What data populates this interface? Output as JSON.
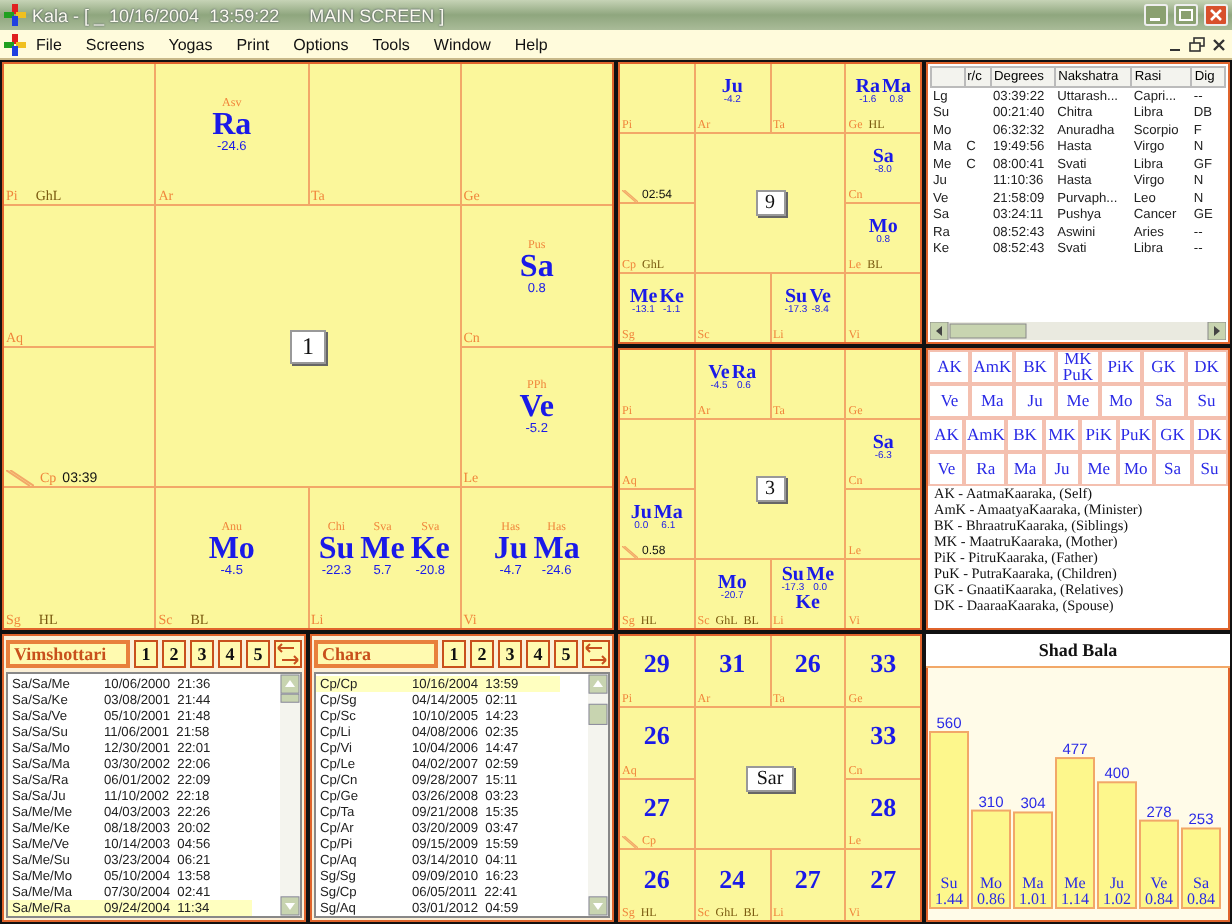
{
  "window": {
    "title": "Kala - [ _ 10/16/2004  13:59:22      MAIN SCREEN ]"
  },
  "menu": [
    "File",
    "Screens",
    "Yogas",
    "Print",
    "Options",
    "Tools",
    "Window",
    "Help"
  ],
  "charts": [
    {
      "kind": "planets",
      "label": "1",
      "cells": [
        {
          "sign": "Pi",
          "ascendant": false,
          "markers": [
            "GhL"
          ]
        },
        {
          "sign": "Ar",
          "ascendant": false,
          "planets": [
            {
              "name": "Ra",
              "nakshatra": "Asv",
              "value": "-24.6"
            }
          ]
        },
        {
          "sign": "Ta",
          "ascendant": false
        },
        {
          "sign": "Ge",
          "ascendant": false
        },
        {
          "sign": "Aq",
          "ascendant": false
        },
        {
          "sign": "Cn",
          "ascendant": false,
          "planets": [
            {
              "name": "Sa",
              "nakshatra": "Pus",
              "value": "0.8"
            }
          ]
        },
        {
          "sign": "Cp",
          "ascendant": true,
          "time": "03:39"
        },
        {
          "sign": "Le",
          "ascendant": false,
          "planets": [
            {
              "name": "Ve",
              "nakshatra": "PPh",
              "value": "-5.2"
            }
          ]
        },
        {
          "sign": "Sg",
          "ascendant": false,
          "markers": [
            "HL"
          ]
        },
        {
          "sign": "Sc",
          "ascendant": false,
          "markers": [
            "BL"
          ],
          "planets": [
            {
              "name": "Mo",
              "nakshatra": "Anu",
              "value": "-4.5"
            }
          ]
        },
        {
          "sign": "Li",
          "ascendant": false,
          "planets": [
            {
              "name": "Su",
              "nakshatra": "Chi",
              "value": "-22.3"
            },
            {
              "name": "Me",
              "nakshatra": "Sva",
              "value": "5.7"
            },
            {
              "name": "Ke",
              "nakshatra": "Sva",
              "value": "-20.8"
            }
          ]
        },
        {
          "sign": "Vi",
          "ascendant": false,
          "planets": [
            {
              "name": "Ju",
              "nakshatra": "Has",
              "value": "-4.7"
            },
            {
              "name": "Ma",
              "nakshatra": "Has",
              "value": "-24.6"
            }
          ]
        }
      ]
    },
    {
      "kind": "planets",
      "label": "9",
      "cells": [
        {
          "sign": "Pi",
          "ascendant": false
        },
        {
          "sign": "Ar",
          "ascendant": false,
          "planets": [
            {
              "name": "Ju",
              "value": "-4.2"
            }
          ]
        },
        {
          "sign": "Ta",
          "ascendant": false
        },
        {
          "sign": "Ge",
          "ascendant": false,
          "markers": [
            "HL"
          ],
          "planets": [
            {
              "name": "Ra",
              "value": "-1.6"
            },
            {
              "name": "Ma",
              "value": "0.8"
            }
          ]
        },
        {
          "ascendant": true,
          "time": "02:54"
        },
        {
          "sign": "Cn",
          "ascendant": false,
          "planets": [
            {
              "name": "Sa",
              "value": "-8.0"
            }
          ]
        },
        {
          "sign": "Cp",
          "ascendant": false,
          "markers": [
            "GhL"
          ]
        },
        {
          "sign": "Le",
          "ascendant": false,
          "markers": [
            "BL"
          ],
          "planets": [
            {
              "name": "Mo",
              "value": "0.8"
            }
          ]
        },
        {
          "sign": "Sg",
          "ascendant": false,
          "planets": [
            {
              "name": "Me",
              "value": "-13.1"
            },
            {
              "name": "Ke",
              "value": "-1.1"
            }
          ]
        },
        {
          "sign": "Sc",
          "ascendant": false
        },
        {
          "sign": "Li",
          "ascendant": false,
          "planets": [
            {
              "name": "Su",
              "value": "-17.3"
            },
            {
              "name": "Ve",
              "value": "-8.4"
            }
          ]
        },
        {
          "sign": "Vi",
          "ascendant": false
        }
      ]
    },
    {
      "kind": "planets",
      "label": "3",
      "cells": [
        {
          "sign": "Pi",
          "ascendant": false
        },
        {
          "sign": "Ar",
          "ascendant": false,
          "planets": [
            {
              "name": "Ve",
              "value": "-4.5"
            },
            {
              "name": "Ra",
              "value": "0.6"
            }
          ]
        },
        {
          "sign": "Ta",
          "ascendant": false
        },
        {
          "sign": "Ge",
          "ascendant": false
        },
        {
          "sign": "Aq",
          "ascendant": false
        },
        {
          "sign": "Cn",
          "ascendant": false,
          "planets": [
            {
              "name": "Sa",
              "value": "-6.3"
            }
          ]
        },
        {
          "ascendant": true,
          "time": "0.58",
          "planets": [
            {
              "name": "Ju",
              "value": "0.0"
            },
            {
              "name": "Ma",
              "value": "6.1"
            }
          ]
        },
        {
          "sign": "Le",
          "ascendant": false
        },
        {
          "sign": "Sg",
          "ascendant": false,
          "markers": [
            "HL"
          ]
        },
        {
          "sign": "Sc",
          "ascendant": false,
          "markers": [
            "GhL",
            "BL"
          ],
          "planets": [
            {
              "name": "Mo",
              "value": "-20.7"
            }
          ]
        },
        {
          "sign": "Li",
          "ascendant": false,
          "planets": [
            {
              "name": "Su",
              "value": "-17.3"
            },
            {
              "name": "Me",
              "value": "0.0"
            },
            {
              "name": "Ke"
            }
          ]
        },
        {
          "sign": "Vi",
          "ascendant": false
        }
      ]
    },
    {
      "kind": "points",
      "label": "Sar",
      "cells": [
        {
          "sign": "Pi",
          "ascendant": false,
          "value": "29"
        },
        {
          "sign": "Ar",
          "ascendant": false,
          "value": "31"
        },
        {
          "sign": "Ta",
          "ascendant": false,
          "value": "26"
        },
        {
          "sign": "Ge",
          "ascendant": false,
          "value": "33"
        },
        {
          "sign": "Aq",
          "ascendant": false,
          "value": "26"
        },
        {
          "sign": "Cn",
          "ascendant": false,
          "value": "33"
        },
        {
          "sign": "Cp",
          "ascendant": true,
          "value": "27"
        },
        {
          "sign": "Le",
          "ascendant": false,
          "value": "28"
        },
        {
          "sign": "Sg",
          "ascendant": false,
          "value": "26",
          "markers": [
            "HL"
          ]
        },
        {
          "sign": "Sc",
          "ascendant": false,
          "value": "24",
          "markers": [
            "GhL",
            "BL"
          ]
        },
        {
          "sign": "Li",
          "ascendant": false,
          "value": "27"
        },
        {
          "sign": "Vi",
          "ascendant": false,
          "value": "27"
        }
      ]
    }
  ],
  "planet_table": {
    "columns": [
      "r/c",
      "Degrees",
      "Nakshatra",
      "Rasi",
      "Dig"
    ],
    "rows": [
      {
        "planet": "Lg",
        "degrees": "03:39:22",
        "nakshatra": "Uttarash...",
        "rasi": "Capri...",
        "dig": "--"
      },
      {
        "planet": "Su",
        "degrees": "00:21:40",
        "nakshatra": "Chitra",
        "rasi": "Libra",
        "dig": "DB"
      },
      {
        "planet": "Mo",
        "degrees": "06:32:32",
        "nakshatra": "Anuradha",
        "rasi": "Scorpio",
        "dig": "F"
      },
      {
        "planet": "Ma",
        "rc": "C",
        "degrees": "19:49:56",
        "nakshatra": "Hasta",
        "rasi": "Virgo",
        "dig": "N"
      },
      {
        "planet": "Me",
        "rc": "C",
        "degrees": "08:00:41",
        "nakshatra": "Svati",
        "rasi": "Libra",
        "dig": "GF"
      },
      {
        "planet": "Ju",
        "degrees": "11:10:36",
        "nakshatra": "Hasta",
        "rasi": "Virgo",
        "dig": "N"
      },
      {
        "planet": "Ve",
        "degrees": "21:58:09",
        "nakshatra": "Purvaph...",
        "rasi": "Leo",
        "dig": "N"
      },
      {
        "planet": "Sa",
        "degrees": "03:24:11",
        "nakshatra": "Pushya",
        "rasi": "Cancer",
        "dig": "GE"
      },
      {
        "planet": "Ra",
        "degrees": "08:52:43",
        "nakshatra": "Aswini",
        "rasi": "Aries",
        "dig": "--"
      },
      {
        "planet": "Ke",
        "degrees": "08:52:43",
        "nakshatra": "Svati",
        "rasi": "Libra",
        "dig": "--"
      }
    ]
  },
  "karaka_tables": [
    {
      "headers": [
        "AK",
        "AmK",
        "BK",
        "MK\nPuK",
        "PiK",
        "GK",
        "DK"
      ],
      "values": [
        "Ve",
        "Ma",
        "Ju",
        "Me",
        "Mo",
        "Sa",
        "Su"
      ]
    },
    {
      "headers": [
        "AK",
        "AmK",
        "BK",
        "MK",
        "PiK",
        "PuK",
        "GK",
        "DK"
      ],
      "values": [
        "Ve",
        "Ra",
        "Ma",
        "Ju",
        "Me",
        "Mo",
        "Sa",
        "Su"
      ]
    }
  ],
  "karaka_legend": [
    "AK - AatmaKaaraka, (Self)",
    "AmK - AmaatyaKaaraka, (Minister)",
    "BK - BhraatruKaaraka, (Siblings)",
    "MK - MaatruKaaraka, (Mother)",
    "PiK - PitruKaaraka, (Father)",
    "PuK - PutraKaaraka, (Children)",
    "GK - GnaatiKaaraka, (Relatives)",
    "DK - DaaraaKaaraka, (Spouse)"
  ],
  "dasa_panels": [
    {
      "title": "Vimshottari",
      "levels": [
        "1",
        "2",
        "3",
        "4",
        "5"
      ],
      "rows": [
        {
          "period": "Sa/Sa/Me",
          "date": "10/06/2000  21:36",
          "selected": false
        },
        {
          "period": "Sa/Sa/Ke",
          "date": "03/08/2001  21:44",
          "selected": false
        },
        {
          "period": "Sa/Sa/Ve",
          "date": "05/10/2001  21:48",
          "selected": false
        },
        {
          "period": "Sa/Sa/Su",
          "date": "11/06/2001  21:58",
          "selected": false
        },
        {
          "period": "Sa/Sa/Mo",
          "date": "12/30/2001  22:01",
          "selected": false
        },
        {
          "period": "Sa/Sa/Ma",
          "date": "03/30/2002  22:06",
          "selected": false
        },
        {
          "period": "Sa/Sa/Ra",
          "date": "06/01/2002  22:09",
          "selected": false
        },
        {
          "period": "Sa/Sa/Ju",
          "date": "11/10/2002  22:18",
          "selected": false
        },
        {
          "period": "Sa/Me/Me",
          "date": "04/03/2003  22:26",
          "selected": false
        },
        {
          "period": "Sa/Me/Ke",
          "date": "08/18/2003  20:02",
          "selected": false
        },
        {
          "period": "Sa/Me/Ve",
          "date": "10/14/2003  04:56",
          "selected": false
        },
        {
          "period": "Sa/Me/Su",
          "date": "03/23/2004  06:21",
          "selected": false
        },
        {
          "period": "Sa/Me/Mo",
          "date": "05/10/2004  13:58",
          "selected": false
        },
        {
          "period": "Sa/Me/Ma",
          "date": "07/30/2004  02:41",
          "selected": false
        },
        {
          "period": "Sa/Me/Ra",
          "date": "09/24/2004  11:34",
          "selected": true
        }
      ]
    },
    {
      "title": "Chara",
      "levels": [
        "1",
        "2",
        "3",
        "4",
        "5"
      ],
      "rows": [
        {
          "period": "Cp/Cp",
          "date": "10/16/2004  13:59",
          "selected": true
        },
        {
          "period": "Cp/Sg",
          "date": "04/14/2005  02:11",
          "selected": false
        },
        {
          "period": "Cp/Sc",
          "date": "10/10/2005  14:23",
          "selected": false
        },
        {
          "period": "Cp/Li",
          "date": "04/08/2006  02:35",
          "selected": false
        },
        {
          "period": "Cp/Vi",
          "date": "10/04/2006  14:47",
          "selected": false
        },
        {
          "period": "Cp/Le",
          "date": "04/02/2007  02:59",
          "selected": false
        },
        {
          "period": "Cp/Cn",
          "date": "09/28/2007  15:11",
          "selected": false
        },
        {
          "period": "Cp/Ge",
          "date": "03/26/2008  03:23",
          "selected": false
        },
        {
          "period": "Cp/Ta",
          "date": "09/21/2008  15:35",
          "selected": false
        },
        {
          "period": "Cp/Ar",
          "date": "03/20/2009  03:47",
          "selected": false
        },
        {
          "period": "Cp/Pi",
          "date": "09/15/2009  15:59",
          "selected": false
        },
        {
          "period": "Cp/Aq",
          "date": "03/14/2010  04:11",
          "selected": false
        },
        {
          "period": "Sg/Sg",
          "date": "09/09/2010  16:23",
          "selected": false
        },
        {
          "period": "Sg/Cp",
          "date": "06/05/2011  22:41",
          "selected": false
        },
        {
          "period": "Sg/Aq",
          "date": "03/01/2012  04:59",
          "selected": false
        }
      ]
    }
  ],
  "shad_bala": {
    "ratios": [
      "1.44",
      "0.86",
      "1.01",
      "1.14",
      "1.02",
      "0.84",
      "0.84"
    ],
    "chart_data": {
      "type": "bar",
      "title": "Shad Bala",
      "categories": [
        "Su",
        "Mo",
        "Ma",
        "Me",
        "Ju",
        "Ve",
        "Sa"
      ],
      "values": [
        560,
        310,
        304,
        477,
        400,
        278,
        253
      ],
      "data_labels": true
    }
  }
}
